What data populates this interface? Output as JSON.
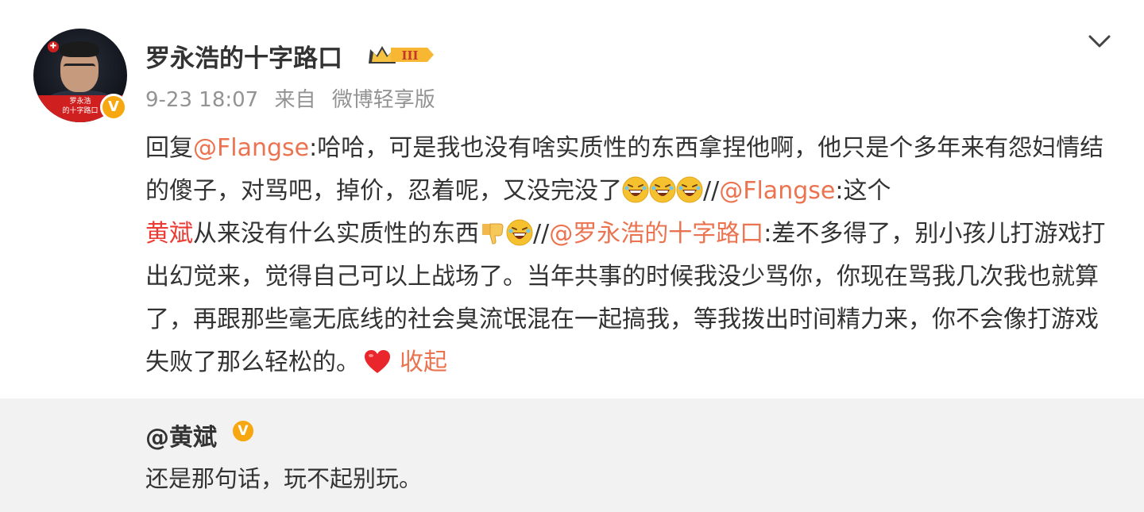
{
  "post": {
    "author": "罗永浩的十字路口",
    "avatar_caption_line1": "罗永浩",
    "avatar_caption_line2": "的十字路口",
    "member_level": "III",
    "verified_badge": "V",
    "time": "9-23 18:07",
    "source_prefix": "来自",
    "source": "微博轻享版",
    "body": {
      "reply_word": "回复",
      "mention1": "@Flangse",
      "text1": ":哈哈，可是我也没有啥实质性的东西拿捏他啊，他只是个多年来有怨妇情结的傻子，对骂吧，掉价，忍着呢，又没完没了",
      "sep1": "//",
      "mention2": "@Flangse",
      "text2": ":这个",
      "highlight_name": "黄斌",
      "text3": "从来没有什么实质性的东西",
      "sep2": "//",
      "mention3": "@罗永浩的十字路口",
      "text4": ":差不多得了，别小孩儿打游戏打出幻觉来，觉得自己可以上战场了。当年共事的时候我没少骂你，你现在骂我几次我也就算了，再跟那些毫无底线的社会臭流氓混在一起搞我，等我拨出时间精力来，你不会像打游戏失败了那么轻松的。",
      "collapse": "收起"
    },
    "icons": {
      "laugh": "laughing-face-emoji",
      "thumbs_down": "thumbs-down-emoji",
      "heart": "red-heart-emoji",
      "chevron": "chevron-down-icon"
    }
  },
  "repost": {
    "user": "@黄斌",
    "verified_badge": "V",
    "text": "还是那句话，玩不起别玩。"
  },
  "colors": {
    "link": "#eb7350",
    "highlight": "#eb3b32",
    "meta": "#939393",
    "badge": "#f7a70f",
    "repost_bg": "#f2f2f2"
  }
}
